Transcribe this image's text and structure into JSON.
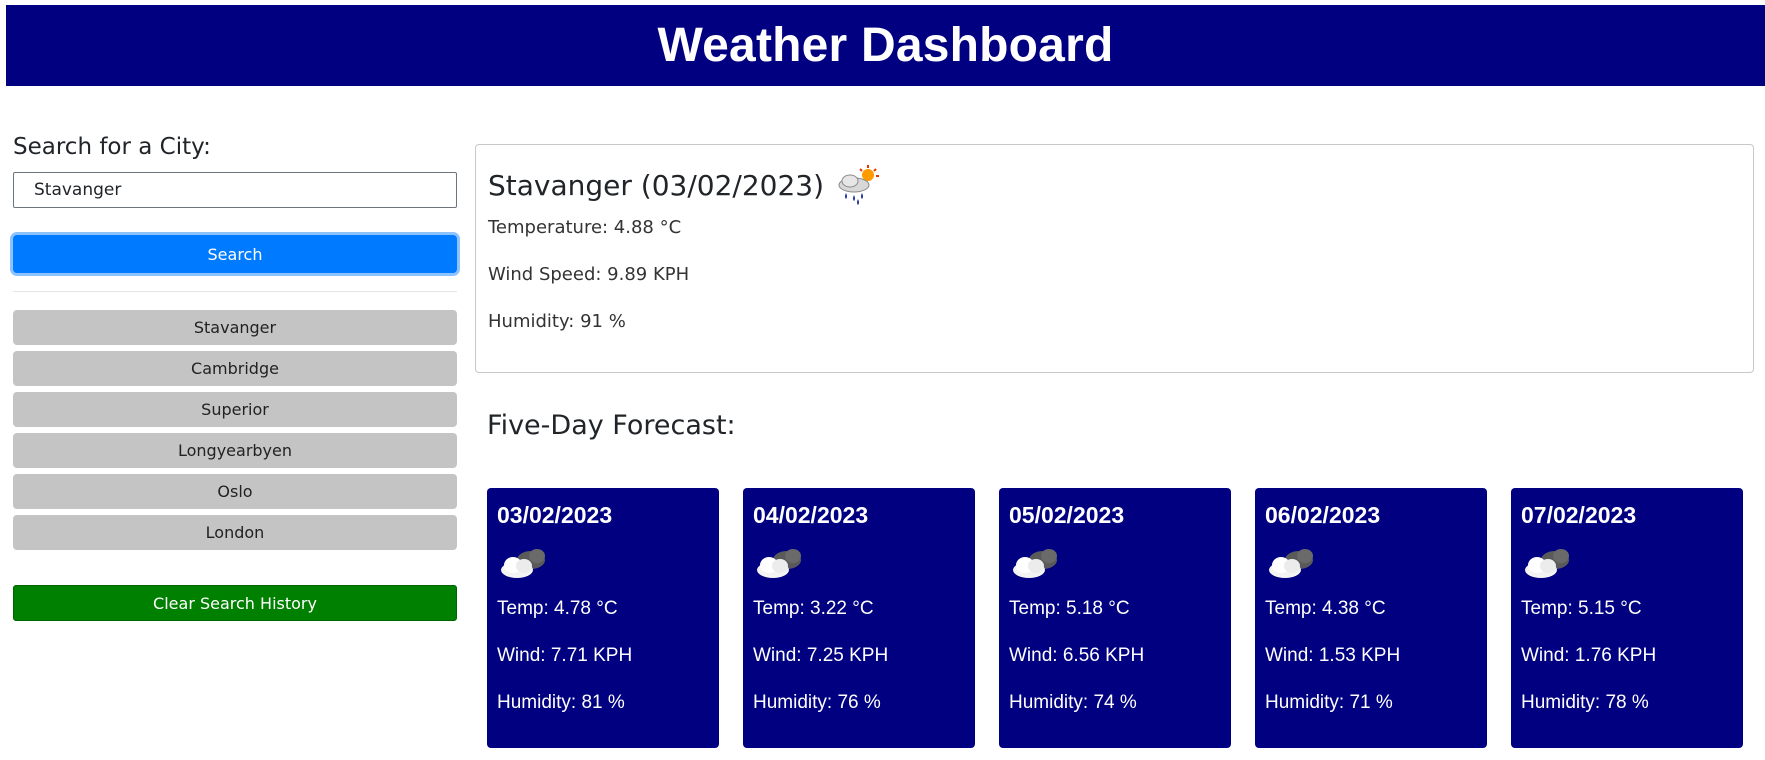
{
  "header": {
    "title": "Weather Dashboard"
  },
  "sidebar": {
    "label": "Search for a City:",
    "search_value": "Stavanger",
    "search_button": "Search",
    "history": [
      "Stavanger",
      "Cambridge",
      "Superior",
      "Longyearbyen",
      "Oslo",
      "London"
    ],
    "clear_button": "Clear Search History"
  },
  "current": {
    "title": "Stavanger (03/02/2023)",
    "icon": "rain-sun-icon",
    "temperature": "Temperature: 4.88 °C",
    "wind": "Wind Speed: 9.89 KPH",
    "humidity": "Humidity: 91 %"
  },
  "forecast": {
    "title": "Five-Day Forecast:",
    "days": [
      {
        "date": "03/02/2023",
        "icon": "broken-clouds-icon",
        "temp": "Temp: 4.78 °C",
        "wind": "Wind: 7.71 KPH",
        "humidity": "Humidity: 81 %"
      },
      {
        "date": "04/02/2023",
        "icon": "broken-clouds-icon",
        "temp": "Temp: 3.22 °C",
        "wind": "Wind: 7.25 KPH",
        "humidity": "Humidity: 76 %"
      },
      {
        "date": "05/02/2023",
        "icon": "broken-clouds-icon",
        "temp": "Temp: 5.18 °C",
        "wind": "Wind: 6.56 KPH",
        "humidity": "Humidity: 74 %"
      },
      {
        "date": "06/02/2023",
        "icon": "broken-clouds-icon",
        "temp": "Temp: 4.38 °C",
        "wind": "Wind: 1.53 KPH",
        "humidity": "Humidity: 71 %"
      },
      {
        "date": "07/02/2023",
        "icon": "broken-clouds-icon",
        "temp": "Temp: 5.15 °C",
        "wind": "Wind: 1.76 KPH",
        "humidity": "Humidity: 78 %"
      }
    ]
  },
  "colors": {
    "header_bg": "#000080",
    "card_bg": "#000080",
    "search_button": "#007bff",
    "clear_button": "#008000",
    "history_button": "#c4c4c4"
  }
}
